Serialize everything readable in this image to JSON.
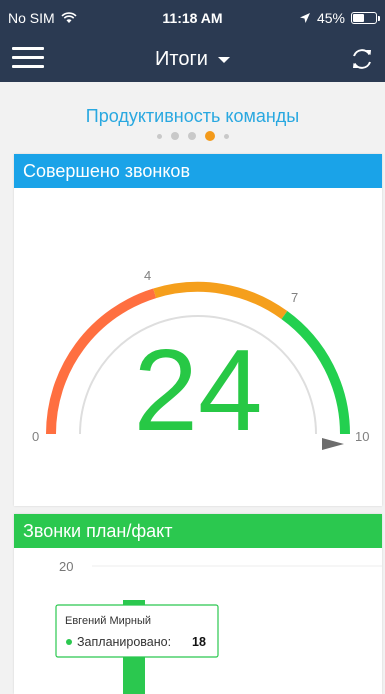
{
  "status_bar": {
    "carrier": "No SIM",
    "time": "11:18 AM",
    "battery": "45%"
  },
  "header": {
    "title": "Итоги"
  },
  "section": {
    "title": "Продуктивность команды",
    "page_count": 5,
    "active_page": 3
  },
  "calls_card": {
    "title": "Совершено звонков",
    "value": "24",
    "gauge_labels": {
      "min": "0",
      "low": "4",
      "mid": "7",
      "max": "10"
    },
    "colors": {
      "low": "#ff6f40",
      "mid": "#f59f1c",
      "high": "#23d04f",
      "value": "#27c845"
    }
  },
  "plan_card": {
    "title": "Звонки план/факт",
    "axis_label": "20",
    "tooltip": {
      "name": "Евгений Мирный",
      "label": "Запланировано:",
      "value": "18"
    }
  }
}
